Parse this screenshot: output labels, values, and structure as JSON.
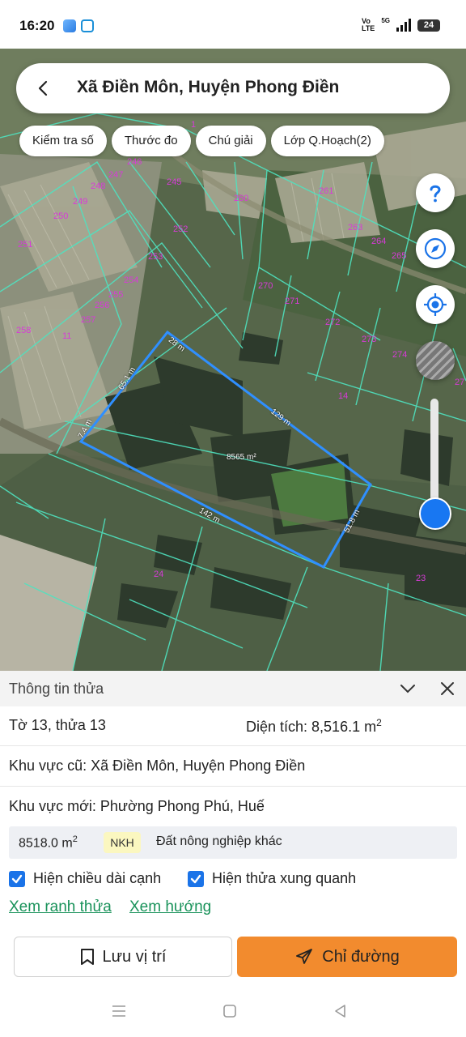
{
  "status_bar": {
    "time": "16:20",
    "volte": "Vo\nLTE",
    "network": "5G",
    "battery": "24"
  },
  "search": {
    "title": "Xã Điền Môn, Huyện Phong Điền"
  },
  "chips": [
    "Kiểm tra số",
    "Thước đo",
    "Chú giải",
    "Lớp Q.Hoạch(2)"
  ],
  "map": {
    "parcel_labels": [
      "1",
      "246",
      "247",
      "248",
      "249",
      "250",
      "251",
      "245",
      "252",
      "253",
      "254",
      "255",
      "256",
      "257",
      "258",
      "11",
      "260",
      "261",
      "263",
      "264",
      "265",
      "270",
      "271",
      "272",
      "273",
      "274",
      "27",
      "14",
      "24",
      "23"
    ],
    "measurements": {
      "top": "28 m",
      "upper_left": "65.1 m",
      "left": "7.4 m",
      "upper_right": "129 m",
      "area": "8565 m²",
      "bottom": "142 m",
      "right": "51.8 m"
    }
  },
  "panel": {
    "title": "Thông tin thửa",
    "sheet_parcel": "Tờ 13, thửa 13",
    "area_label": "Diện tích: 8,516.1 m",
    "area_sup": "2",
    "old_area": "Khu vực cũ: Xã Điền Môn, Huyện Phong Điền",
    "new_area": "Khu vực mới: Phường Phong Phú, Huế",
    "land_use": {
      "area": "8518.0 m",
      "area_sup": "2",
      "code": "NKH",
      "description": "Đất nông nghiệp khác"
    },
    "check_edge_length": "Hiện chiều dài cạnh",
    "check_neighbors": "Hiện thửa xung quanh",
    "link_boundary": "Xem ranh thửa",
    "link_direction": "Xem hướng",
    "btn_save": "Lưu vị trí",
    "btn_route": "Chỉ đường"
  },
  "colors": {
    "accent": "#1a73e8",
    "route_button": "#f28b2e",
    "link": "#19925a",
    "parcel_line": "#4fe3c0",
    "selection": "#2f8fff"
  }
}
